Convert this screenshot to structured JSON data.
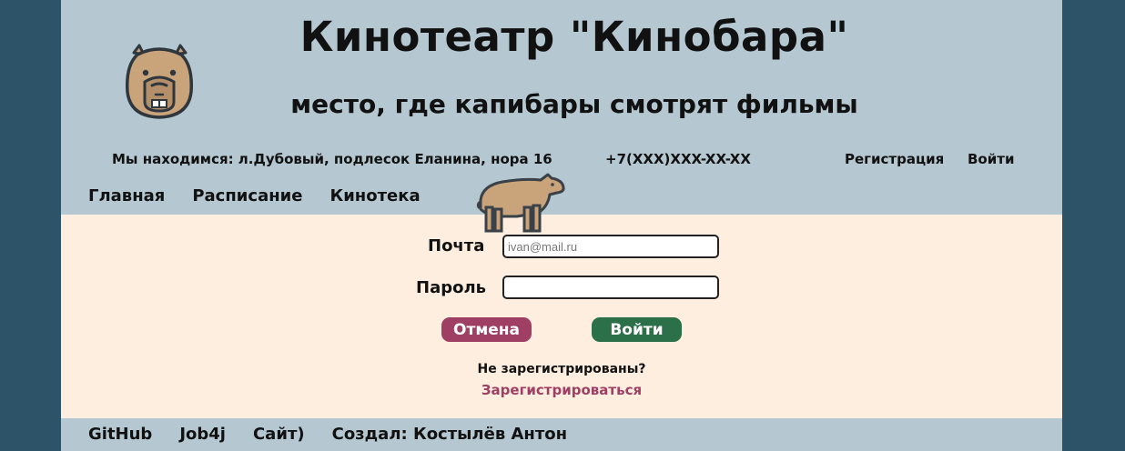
{
  "header": {
    "title": "Кинотеатр \"Кинобара\"",
    "subtitle": "место, где капибары смотрят фильмы",
    "address": "Мы находимся: л.Дубовый, подлесок Еланина, нора 16",
    "phone": "+7(XXX)XXX-XX-XX",
    "register_link": "Регистрация",
    "login_link": "Войти"
  },
  "nav": {
    "items": [
      "Главная",
      "Расписание",
      "Кинотека"
    ]
  },
  "login_form": {
    "email_label": "Почта",
    "email_placeholder": "ivan@mail.ru",
    "email_value": "",
    "password_label": "Пароль",
    "password_value": "",
    "cancel_button": "Отмена",
    "submit_button": "Войти",
    "not_registered_text": "Не зарегистрированы?",
    "register_link": "Зарегистрироваться"
  },
  "footer": {
    "github": "GitHub",
    "job4j": "Job4j",
    "site": "Сайт)",
    "author": "Создал: Костылёв Антон"
  },
  "icons": {
    "logo": "capybara-face-icon",
    "mascot": "capybara-icon"
  },
  "colors": {
    "background_outer": "#2c5368",
    "header_bg": "#b5c8d1",
    "content_bg": "#fdeee0",
    "cancel_button": "#9e3f63",
    "submit_button": "#2b7048",
    "register_link": "#9e3f63",
    "capybara_fur": "#c9a37a",
    "capybara_outline": "#3a4148"
  }
}
